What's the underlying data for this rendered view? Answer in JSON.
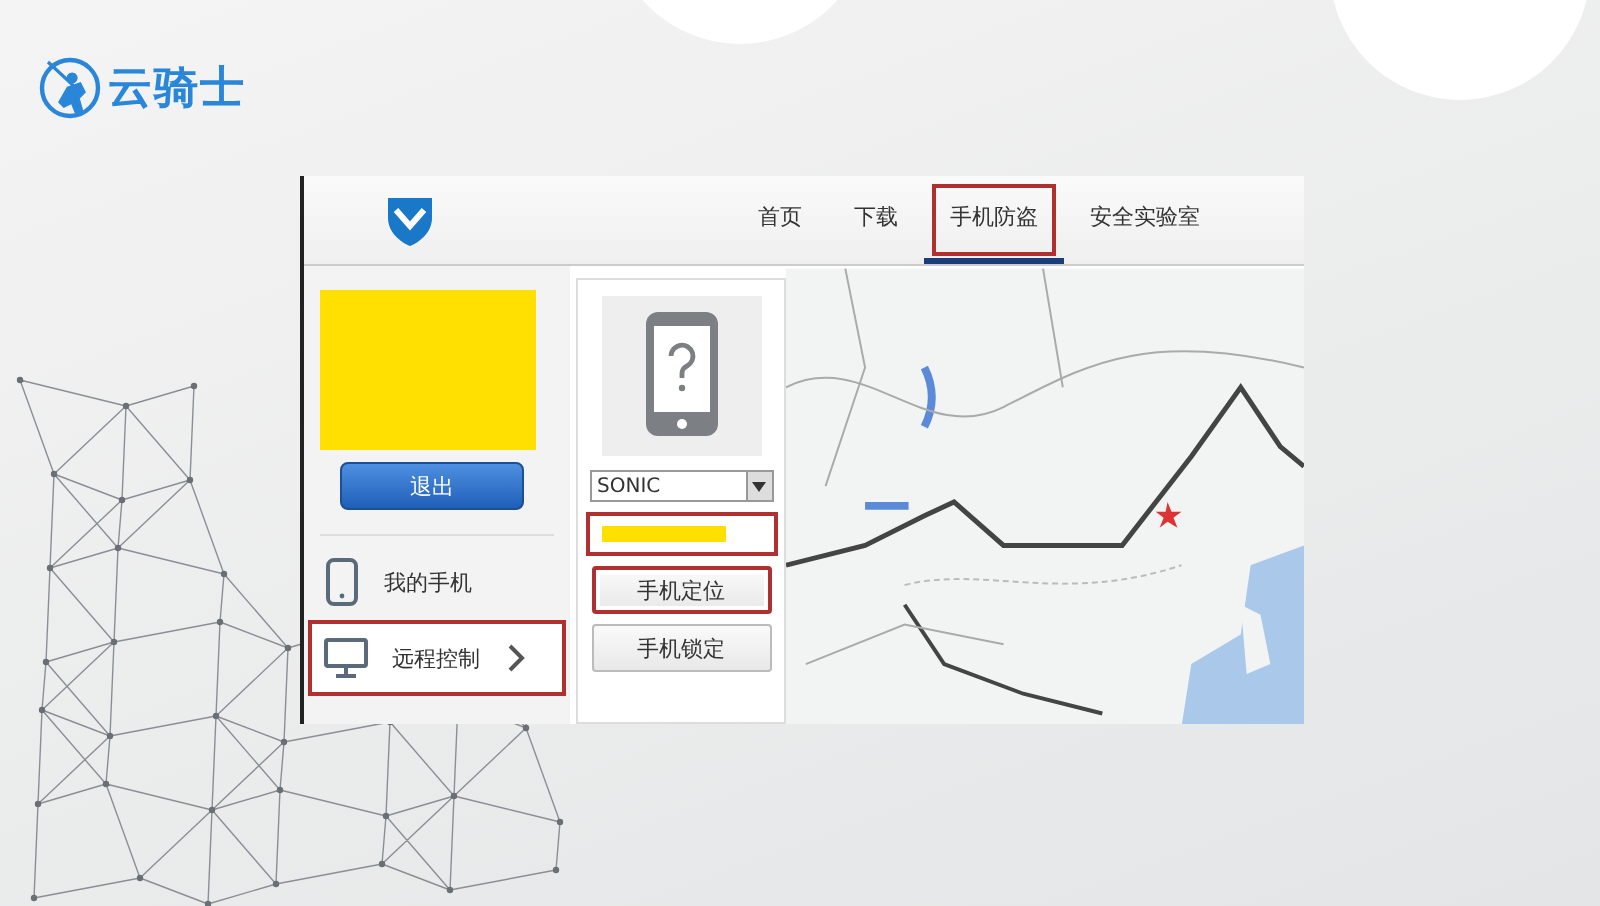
{
  "brand": {
    "name": "云骑士"
  },
  "app": {
    "nav": [
      {
        "label": "首页",
        "selected": false,
        "highlighted": false
      },
      {
        "label": "下载",
        "selected": false,
        "highlighted": false
      },
      {
        "label": "手机防盗",
        "selected": true,
        "highlighted": true
      },
      {
        "label": "安全实验室",
        "selected": false,
        "highlighted": false
      }
    ],
    "logout_button": "退出",
    "sidebar": [
      {
        "label": "我的手机",
        "kind": "phone",
        "selected": false,
        "highlighted": false
      },
      {
        "label": "远程控制",
        "kind": "monitor",
        "selected": true,
        "highlighted": true
      }
    ],
    "device": {
      "select_value": "SONIC",
      "account_field": {
        "highlighted": true
      },
      "buttons": [
        {
          "label": "手机定位",
          "highlighted": true
        },
        {
          "label": "手机锁定",
          "highlighted": false
        }
      ]
    }
  }
}
